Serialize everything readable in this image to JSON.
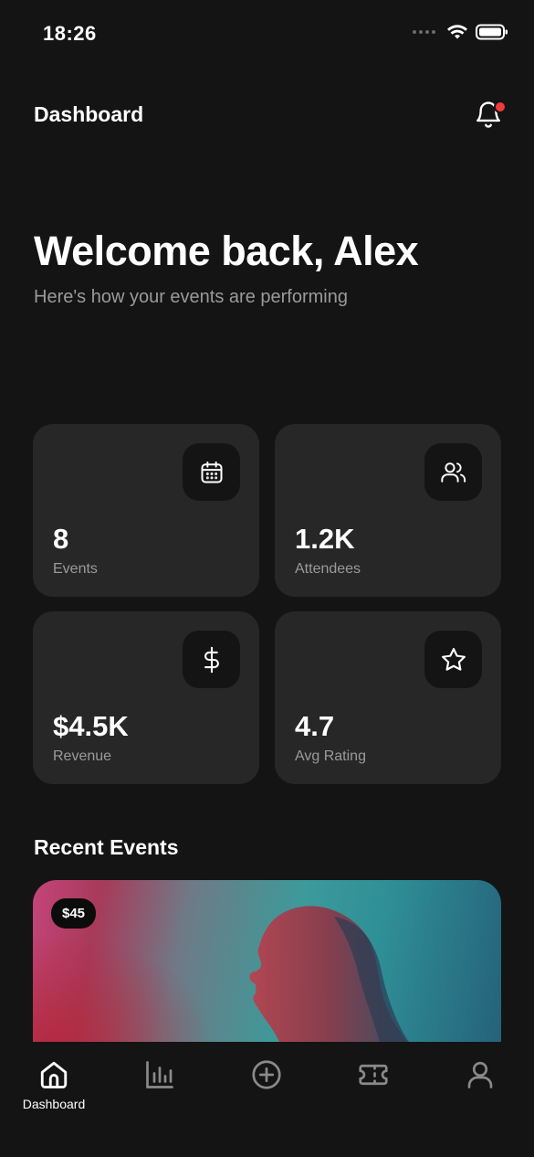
{
  "status": {
    "time": "18:26"
  },
  "header": {
    "title": "Dashboard"
  },
  "welcome": {
    "title": "Welcome back, Alex",
    "subtitle": "Here's how your events are performing"
  },
  "stats": [
    {
      "value": "8",
      "label": "Events",
      "icon": "calendar-icon"
    },
    {
      "value": "1.2K",
      "label": "Attendees",
      "icon": "users-icon"
    },
    {
      "value": "$4.5K",
      "label": "Revenue",
      "icon": "dollar-icon"
    },
    {
      "value": "4.7",
      "label": "Avg Rating",
      "icon": "star-icon"
    }
  ],
  "recent": {
    "title": "Recent Events",
    "events": [
      {
        "price": "$45"
      }
    ]
  },
  "tabs": [
    {
      "label": "Dashboard",
      "icon": "home-icon",
      "active": true
    },
    {
      "label": "",
      "icon": "bar-chart-icon",
      "active": false
    },
    {
      "label": "",
      "icon": "plus-circle-icon",
      "active": false
    },
    {
      "label": "",
      "icon": "ticket-icon",
      "active": false
    },
    {
      "label": "",
      "icon": "user-icon",
      "active": false
    }
  ],
  "colors": {
    "background": "#141414",
    "card": "#272727",
    "notification_dot": "#ef3b3b",
    "muted_text": "#9a9a9a"
  }
}
